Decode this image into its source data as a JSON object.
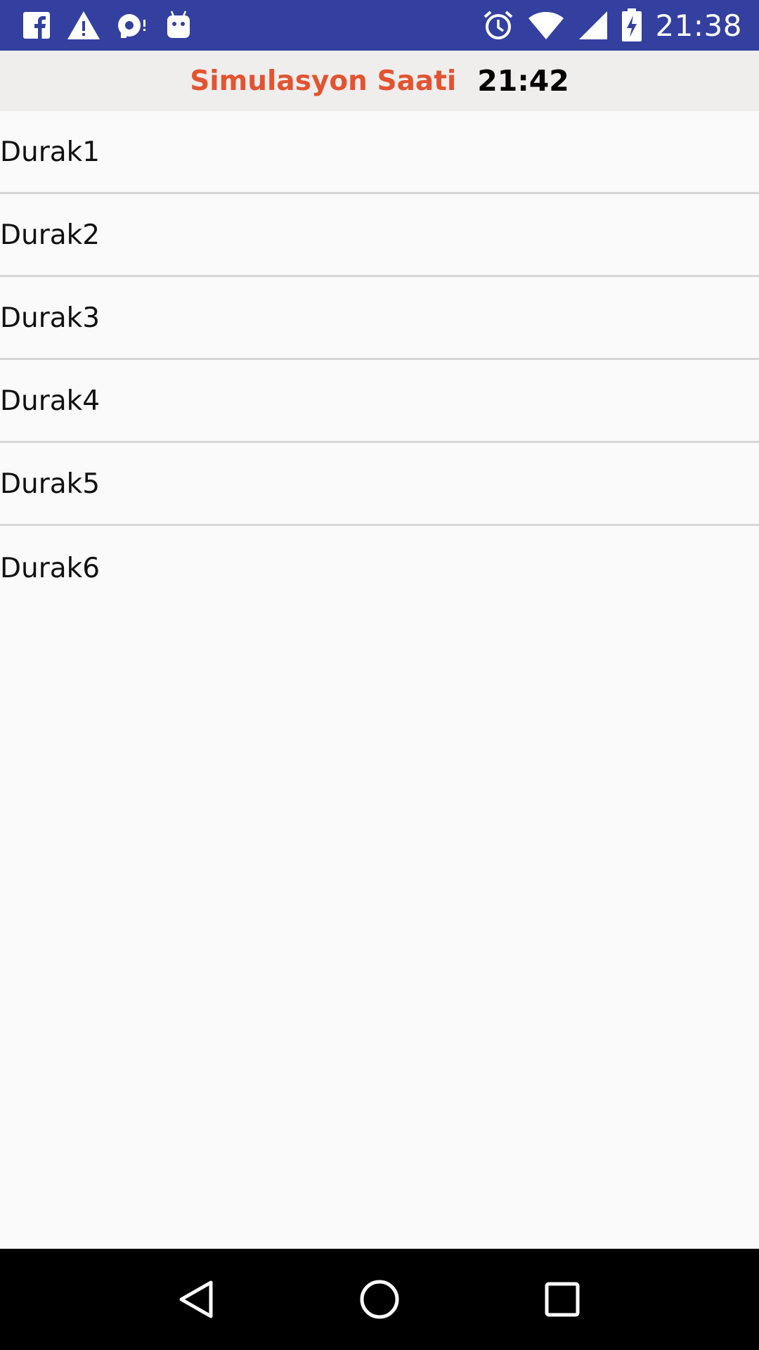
{
  "status_bar": {
    "time": "21:38",
    "left_icons": [
      "facebook-icon",
      "warning-icon",
      "media-icon",
      "android-icon"
    ],
    "right_icons": [
      "alarm-icon",
      "wifi-icon",
      "signal-icon",
      "battery-charging-icon"
    ],
    "background_color": "#3340a0"
  },
  "header": {
    "label": "Simulasyon Saati",
    "time": "21:42",
    "label_color": "#e25431"
  },
  "list": {
    "items": [
      "Durak1",
      "Durak2",
      "Durak3",
      "Durak4",
      "Durak5",
      "Durak6"
    ]
  },
  "nav_bar": {
    "buttons": [
      "back-icon",
      "home-icon",
      "recents-icon"
    ]
  }
}
